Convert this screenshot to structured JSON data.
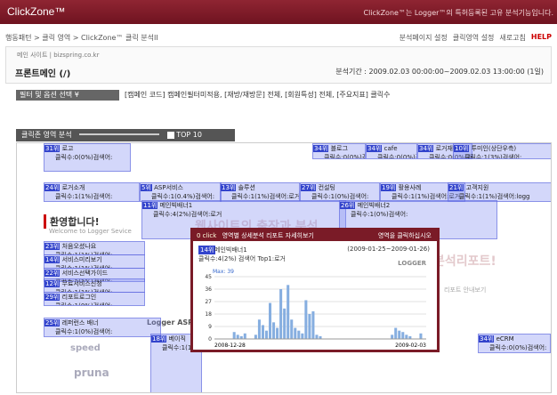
{
  "app": {
    "title": "ClickZone™",
    "notice": "ClickZone™는 Logger™의 특허등록된 고유 분석기능입니다."
  },
  "breadcrumb": "행동패턴 > 클릭 영역 > ClickZone™ 클릭 분석II",
  "toolbar": {
    "analysis_settings": "분석페이지 설정",
    "click_area_settings": "클릭영역 설정",
    "refresh": "새로고침",
    "help": "HELP"
  },
  "site": {
    "label": "메인 사이트 | bizspring.co.kr",
    "page": "프론트메인 (/)",
    "period": "분석기간 : 2009.02.03 00:00:00~2009.02.03 13:00:00 (1일)"
  },
  "filter": {
    "button": "필터 및 옵션 선택 ¥",
    "text": "[캠페인 코드] 캠페인필터미적용, [재방/재방문] 전체, [회원특성] 전체, [주요지표] 클릭수"
  },
  "heatbar": {
    "label": "클릭존 영역 분석",
    "top": "TOP 10"
  },
  "zones": [
    {
      "rank": "31위",
      "title": "로고",
      "clicks": "클릭수:0(0%)검색어:"
    },
    {
      "rank": "34위",
      "title": "블로그",
      "clicks": "클릭수:0(0%)검색어:"
    },
    {
      "rank": "34위",
      "title": "cafe",
      "clicks": "클릭수:0(0%)검색어:"
    },
    {
      "rank": "34위",
      "title": "로거재팬",
      "clicks": "클릭수:0(0%)검색어:"
    },
    {
      "rank": "10위",
      "title": "투미인(상단우측)",
      "clicks": "클릭수:1(3%)검색어:"
    },
    {
      "rank": "24위",
      "title": "로거소개",
      "clicks": "클릭수:1(1%)검색어:"
    },
    {
      "rank": "5위",
      "title": "ASP서비스",
      "clicks": "클릭수:1(0.4%)검색어:"
    },
    {
      "rank": "13위",
      "title": "솔루션",
      "clicks": "클릭수:1(1%)검색어:로거"
    },
    {
      "rank": "27위",
      "title": "컨설팅",
      "clicks": "클릭수:1(0%)검색어:"
    },
    {
      "rank": "19위",
      "title": "활용사례",
      "clicks": "클릭수:1(1%)검색어:로거"
    },
    {
      "rank": "21위",
      "title": "고객지원",
      "clicks": "클릭수:1(1%)검색어:logg"
    },
    {
      "rank": "11위",
      "title": "메인빅배너1",
      "clicks": "클릭수:4(2%)검색어:로거"
    },
    {
      "rank": "26위",
      "title": "메인빅배너2",
      "clicks": "클릭수:1(0%)검색어:"
    },
    {
      "rank": "23위",
      "title": "처음오셨나요",
      "clicks": "클릭수:1(1%)검색어:"
    },
    {
      "rank": "14위",
      "title": "서비스미리보기",
      "clicks": "클릭수:1(1%)검색어:"
    },
    {
      "rank": "22위",
      "title": "서비스선택가이드",
      "clicks": "클릭수:1(1%)검색어:"
    },
    {
      "rank": "12위",
      "title": "무료서비스신청",
      "clicks": "클릭수:1(1%)검색어:"
    },
    {
      "rank": "29위",
      "title": "리포트로그인",
      "clicks": "클릭수:1(0%)검색어:"
    },
    {
      "rank": "25위",
      "title": "레퍼런스 배너",
      "clicks": "클릭수:1(0%)검색어:"
    },
    {
      "rank": "18위",
      "title": "베이직",
      "clicks": "클릭수:1(1%)검색어:"
    },
    {
      "rank": "34위",
      "title": "eCRM",
      "clicks": "클릭수:0(0%)검색어:"
    }
  ],
  "welcome": {
    "title": "환영합니다!",
    "sub": "Welcome to Logger Sevice"
  },
  "background_text": {
    "headline": "웹사이트의 출장과 분석",
    "right_ad": "분석리포트!",
    "logger_asp": "Logger ASP",
    "speed": "speed",
    "pruna": "pruna",
    "report_guide": "리포트 안내보기"
  },
  "popup": {
    "header": "영역별 상세분석 리포트 자세히보기",
    "click_label": "0 click",
    "go": "영역을 클릭하십시오",
    "rank": "14위",
    "title": "메인빅배너1",
    "range": "(2009-01-25~2009-01-26)",
    "summary": "클릭수:4(2%) 검색어 Top1:로거",
    "brand": "LOGGER",
    "max_label": "Max: 39"
  },
  "chart_data": {
    "type": "bar",
    "title": "",
    "xlabel": "",
    "ylabel": "",
    "ylim": [
      0,
      45
    ],
    "yticks": [
      0,
      9,
      18,
      27,
      36,
      45
    ],
    "x_start": "2008-12-28",
    "x_end": "2009-02-03",
    "values": [
      0,
      0,
      0,
      0,
      0,
      5,
      3,
      2,
      4,
      0,
      0,
      3,
      14,
      10,
      6,
      26,
      12,
      8,
      36,
      22,
      39,
      14,
      8,
      6,
      4,
      28,
      18,
      20,
      3,
      2,
      0,
      0,
      0,
      0,
      0,
      0,
      0,
      0,
      0,
      0,
      0,
      0,
      0,
      0,
      0,
      0,
      0,
      0,
      0,
      3,
      8,
      6,
      5,
      3,
      2,
      0,
      0,
      4,
      0
    ]
  },
  "colors": {
    "brand": "#7a1b27",
    "zone": "#828cf0",
    "rank": "#3344cc",
    "bar": "#86aee0"
  }
}
